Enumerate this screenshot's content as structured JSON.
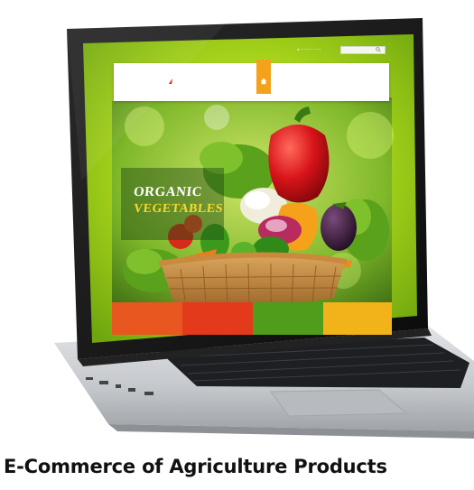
{
  "caption": "E-Commerce of Agriculture Products",
  "website": {
    "logo_text": "",
    "nav_items": [
      "",
      "",
      "",
      "",
      ""
    ],
    "hero": {
      "title_line1": "ORGANIC",
      "title_line2": "VEGETABLES",
      "subtitle": ""
    },
    "tiles": [
      {
        "label": "",
        "color": "#e8571f"
      },
      {
        "label": "",
        "color": "#e23a1a"
      },
      {
        "label": "",
        "color": "#4f9d1a"
      },
      {
        "label": "",
        "color": "#f2b21a"
      }
    ]
  },
  "icons": [
    "home-icon",
    "search-icon",
    "logo-leaf-icon"
  ],
  "colors": {
    "screen_green": "#a5d21a",
    "accent_orange": "#f4a21c",
    "laptop_silver": "#c9ccd0",
    "laptop_black": "#141414"
  }
}
